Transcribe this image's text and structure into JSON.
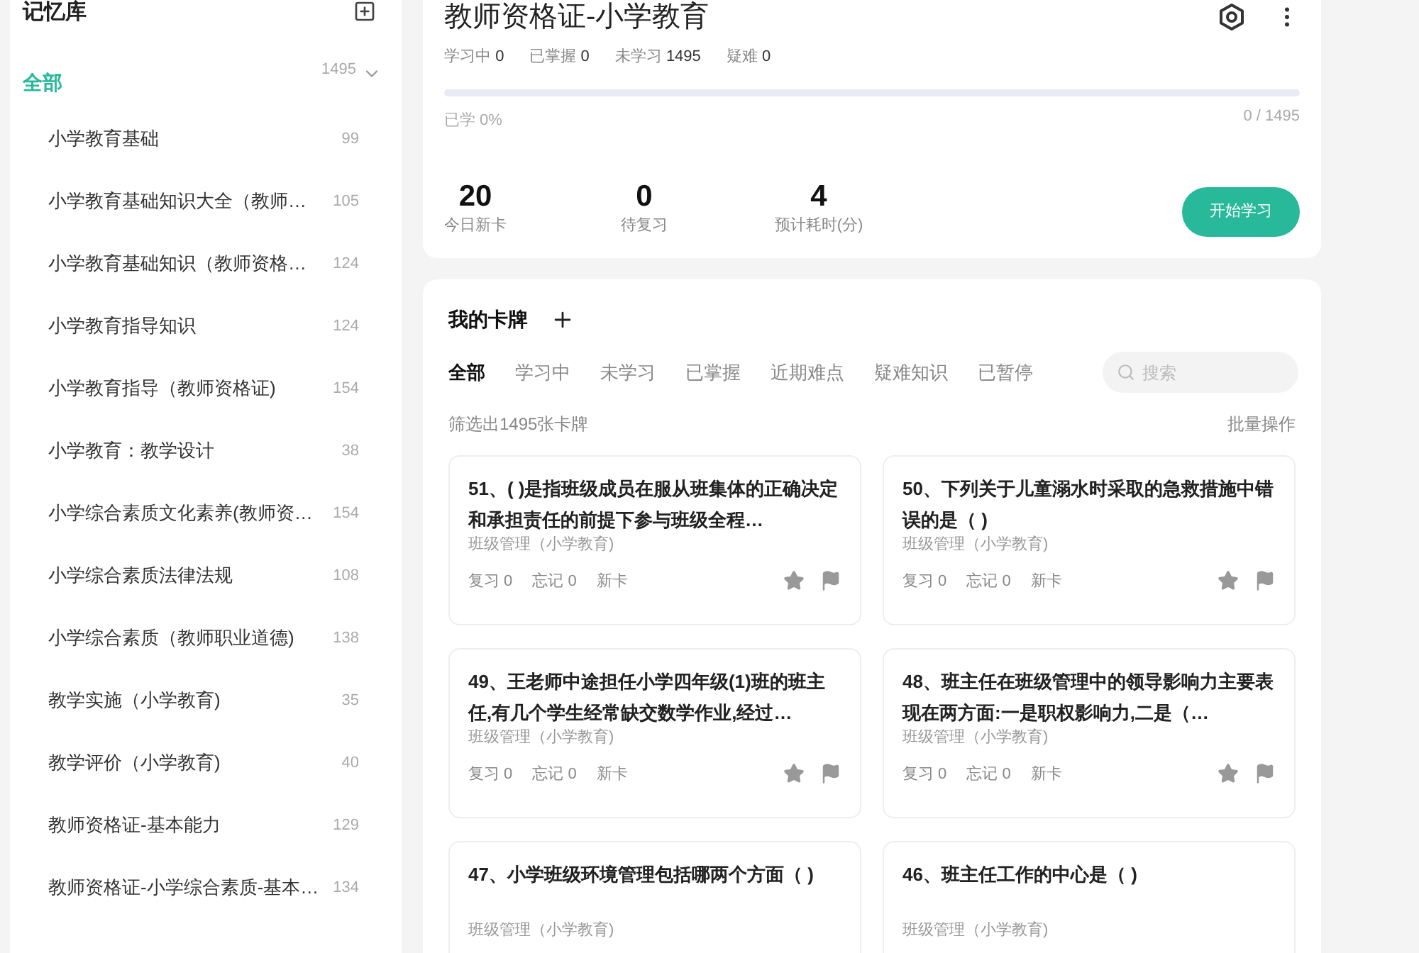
{
  "sidebar": {
    "title": "记忆库",
    "tree": [
      {
        "label": "全部",
        "count": "1495",
        "selected": true,
        "expanded": true,
        "children": [
          {
            "label": "小学教育基础",
            "count": "99",
            "selected": false
          },
          {
            "label": "小学教育基础知识大全（教师…",
            "count": "105",
            "selected": false
          },
          {
            "label": "小学教育基础知识（教师资格…",
            "count": "124",
            "selected": false
          },
          {
            "label": "小学教育指导知识",
            "count": "124",
            "selected": false
          },
          {
            "label": "小学教育指导（教师资格证)",
            "count": "154",
            "selected": false
          },
          {
            "label": "小学教育：教学设计",
            "count": "38",
            "selected": false
          },
          {
            "label": "小学综合素质文化素养(教师资…",
            "count": "154",
            "selected": false
          },
          {
            "label": "小学综合素质法律法规",
            "count": "108",
            "selected": false
          },
          {
            "label": "小学综合素质（教师职业道德)",
            "count": "138",
            "selected": false
          },
          {
            "label": "教学实施（小学教育)",
            "count": "35",
            "selected": false
          },
          {
            "label": "教学评价（小学教育)",
            "count": "40",
            "selected": false
          },
          {
            "label": "教师资格证-基本能力",
            "count": "129",
            "selected": false
          },
          {
            "label": "教师资格证-小学综合素质-基本…",
            "count": "134",
            "selected": false
          }
        ]
      }
    ]
  },
  "deck": {
    "title": "教师资格证-小学教育",
    "stats": [
      {
        "label": "学习中",
        "value": "0"
      },
      {
        "label": "已掌握",
        "value": "0"
      },
      {
        "label": "未学习",
        "value": "1495"
      },
      {
        "label": "疑难",
        "value": "0"
      }
    ],
    "progress": {
      "level": 0,
      "label": "已学 0%",
      "reading": "0 / 1495"
    },
    "summary": [
      {
        "value": "20",
        "label": "今日新卡"
      },
      {
        "value": "0",
        "label": "待复习"
      },
      {
        "value": "4",
        "label": "预计耗时(分)"
      }
    ],
    "start_button": "开始学习"
  },
  "cards_panel": {
    "title": "我的卡牌",
    "tabs": [
      {
        "label": "全部",
        "selected": true
      },
      {
        "label": "学习中",
        "selected": false
      },
      {
        "label": "未学习",
        "selected": false
      },
      {
        "label": "已掌握",
        "selected": false
      },
      {
        "label": "近期难点",
        "selected": false
      },
      {
        "label": "疑难知识",
        "selected": false
      },
      {
        "label": "已暂停",
        "selected": false
      }
    ],
    "search": {
      "placeholder": "搜索"
    },
    "filter_result": "筛选出1495张卡牌",
    "batch_action": "批量操作",
    "cards": [
      {
        "title": "51、( )是指班级成员在服从班集体的正确决定和承担责任的前提下参与班级全程…",
        "category": "班级管理（小学教育)",
        "review": "复习 0",
        "forget": "忘记 0",
        "status": "新卡"
      },
      {
        "title": "50、下列关于儿童溺水时采取的急救措施中错误的是（ )",
        "category": "班级管理（小学教育)",
        "review": "复习 0",
        "forget": "忘记 0",
        "status": "新卡"
      },
      {
        "title": "49、王老师中途担任小学四年级(1)班的班主任,有几个学生经常缺交数学作业,经过…",
        "category": "班级管理（小学教育)",
        "review": "复习 0",
        "forget": "忘记 0",
        "status": "新卡"
      },
      {
        "title": "48、班主任在班级管理中的领导影响力主要表现在两方面:一是职权影响力,二是（…",
        "category": "班级管理（小学教育)",
        "review": "复习 0",
        "forget": "忘记 0",
        "status": "新卡"
      },
      {
        "title": "47、小学班级环境管理包括哪两个方面（ )",
        "category": "班级管理（小学教育)"
      },
      {
        "title": "46、班主任工作的中心是（ )",
        "category": "班级管理（小学教育)"
      }
    ]
  }
}
